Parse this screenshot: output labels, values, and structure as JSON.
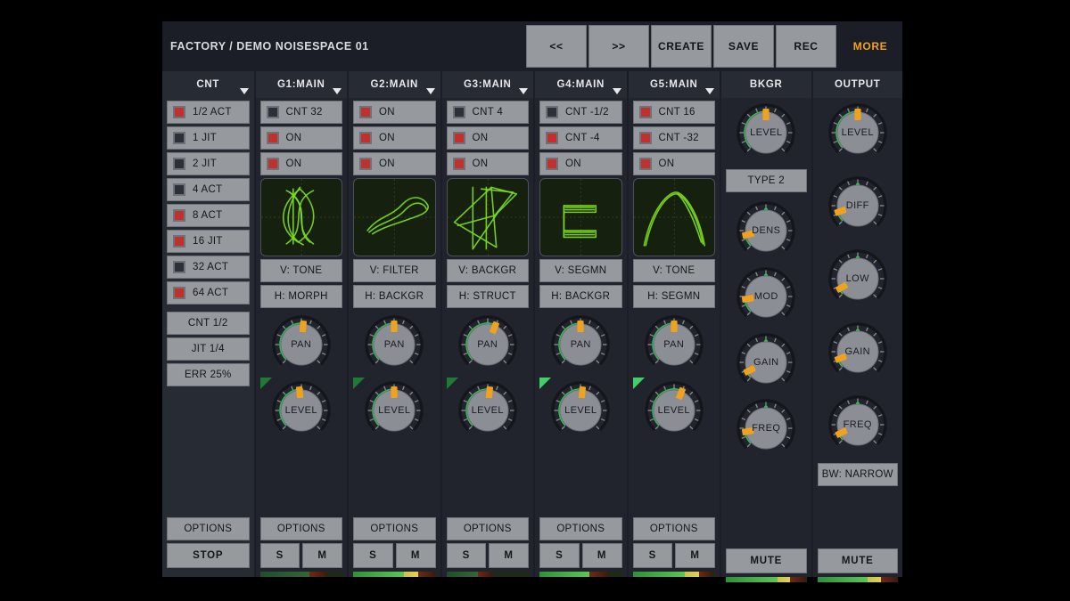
{
  "header": {
    "preset_name": "FACTORY / DEMO NOISESPACE 01",
    "buttons": [
      {
        "label": "<<",
        "name": "prev-button",
        "active": false
      },
      {
        "label": ">>",
        "name": "next-button",
        "active": false
      },
      {
        "label": "CREATE",
        "name": "create-button",
        "active": false
      },
      {
        "label": "SAVE",
        "name": "save-button",
        "active": false
      },
      {
        "label": "REC",
        "name": "rec-button",
        "active": false
      },
      {
        "label": "MORE",
        "name": "more-button",
        "active": true
      }
    ],
    "accent_color": "#f0a21e"
  },
  "columns": {
    "cnt": {
      "title": "CNT",
      "toggles": [
        {
          "label": "1/2 ACT",
          "on": true
        },
        {
          "label": "1 JIT",
          "on": false
        },
        {
          "label": "2 JIT",
          "on": false
        },
        {
          "label": "4 ACT",
          "on": false
        },
        {
          "label": "8 ACT",
          "on": true
        },
        {
          "label": "16 JIT",
          "on": true
        },
        {
          "label": "32 ACT",
          "on": false
        },
        {
          "label": "64 ACT",
          "on": true
        }
      ],
      "params": [
        "CNT 1/2",
        "JIT 1/4",
        "ERR 25%"
      ],
      "options_label": "OPTIONS",
      "stop_label": "STOP"
    },
    "groups": [
      {
        "title": "G1:MAIN",
        "toggles": [
          {
            "label": "CNT 32",
            "on": false
          },
          {
            "label": "ON",
            "on": true
          },
          {
            "label": "ON",
            "on": true
          }
        ],
        "scope": "lissajous-figure-eight",
        "v_label": "V: TONE",
        "h_label": "H: MORPH",
        "pan": {
          "label": "PAN",
          "value": 0.52
        },
        "level": {
          "label": "LEVEL",
          "value": 0.48,
          "indicator_bright": false
        },
        "options_label": "OPTIONS",
        "solo_label": "S",
        "mute_label": "M",
        "meter": {
          "green": 0.6,
          "yellow": 0.0,
          "red": 0.22,
          "dim": true
        }
      },
      {
        "title": "G2:MAIN",
        "toggles": [
          {
            "label": "ON",
            "on": true
          },
          {
            "label": "ON",
            "on": true
          },
          {
            "label": "ON",
            "on": true
          }
        ],
        "scope": "sine-sweep",
        "v_label": "V: FILTER",
        "h_label": "H: BACKGR",
        "pan": {
          "label": "PAN",
          "value": 0.5
        },
        "level": {
          "label": "LEVEL",
          "value": 0.5,
          "indicator_bright": false
        },
        "options_label": "OPTIONS",
        "solo_label": "S",
        "mute_label": "M",
        "meter": {
          "green": 0.62,
          "yellow": 0.17,
          "red": 0.21,
          "dim": false
        }
      },
      {
        "title": "G3:MAIN",
        "toggles": [
          {
            "label": "CNT 4",
            "on": false
          },
          {
            "label": "ON",
            "on": true
          },
          {
            "label": "ON",
            "on": true
          }
        ],
        "scope": "triangle-wave-complex",
        "v_label": "V: BACKGR",
        "h_label": "H: STRUCT",
        "pan": {
          "label": "PAN",
          "value": 0.58
        },
        "level": {
          "label": "LEVEL",
          "value": 0.52,
          "indicator_bright": false
        },
        "options_label": "OPTIONS",
        "solo_label": "S",
        "mute_label": "M",
        "meter": {
          "green": 0.38,
          "yellow": 0.0,
          "red": 0.18,
          "dim": true
        }
      },
      {
        "title": "G4:MAIN",
        "toggles": [
          {
            "label": "CNT -1/2",
            "on": false
          },
          {
            "label": "CNT -4",
            "on": true
          },
          {
            "label": "ON",
            "on": true
          }
        ],
        "scope": "square-bracket-burst",
        "v_label": "V: SEGMN",
        "h_label": "H: BACKGR",
        "pan": {
          "label": "PAN",
          "value": 0.5
        },
        "level": {
          "label": "LEVEL",
          "value": 0.52,
          "indicator_bright": true
        },
        "options_label": "OPTIONS",
        "solo_label": "S",
        "mute_label": "M",
        "meter": {
          "green": 0.6,
          "yellow": 0.0,
          "red": 0.24,
          "dim": false
        }
      },
      {
        "title": "G5:MAIN",
        "toggles": [
          {
            "label": "CNT 16",
            "on": true
          },
          {
            "label": "CNT -32",
            "on": true
          },
          {
            "label": "ON",
            "on": true
          }
        ],
        "scope": "arch-curve",
        "v_label": "V: TONE",
        "h_label": "H: SEGMN",
        "pan": {
          "label": "PAN",
          "value": 0.5
        },
        "level": {
          "label": "LEVEL",
          "value": 0.58,
          "indicator_bright": true
        },
        "options_label": "OPTIONS",
        "solo_label": "S",
        "mute_label": "M",
        "meter": {
          "green": 0.63,
          "yellow": 0.18,
          "red": 0.16,
          "dim": false
        }
      }
    ],
    "bkgr": {
      "title": "BKGR",
      "level": {
        "label": "LEVEL",
        "value": 0.5
      },
      "type_label": "TYPE 2",
      "dens": {
        "label": "DENS",
        "value": 0.12
      },
      "mod": {
        "label": "MOD",
        "value": 0.14
      },
      "gain": {
        "label": "GAIN",
        "value": 0.07
      },
      "freq": {
        "label": "FREQ",
        "value": 0.13
      },
      "mute_label": "MUTE",
      "meter": {
        "green": 0.64,
        "yellow": 0.16,
        "red": 0.2,
        "dim": false
      }
    },
    "output": {
      "title": "OUTPUT",
      "level": {
        "label": "LEVEL",
        "value": 0.5
      },
      "diff": {
        "label": "DIFF",
        "value": 0.1
      },
      "low": {
        "label": "LOW",
        "value": 0.06
      },
      "gain": {
        "label": "GAIN",
        "value": 0.09
      },
      "freq": {
        "label": "FREQ",
        "value": 0.07
      },
      "bw_label": "BW: NARROW",
      "mute_label": "MUTE",
      "meter": {
        "green": 0.62,
        "yellow": 0.17,
        "red": 0.21,
        "dim": false
      }
    }
  }
}
